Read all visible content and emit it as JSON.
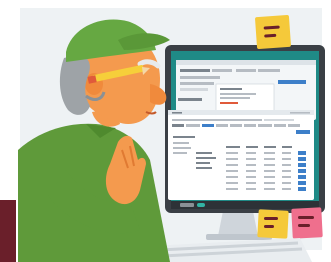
{
  "colors": {
    "background": "#ffffff",
    "backdrop": "#eef2f4",
    "monitor_bezel": "#3a3f45",
    "screen_teal": "#1f8a86",
    "window_white": "#ffffff",
    "accent_blue": "#3d7fc9",
    "accent_red": "#e05a3a",
    "sticky_yellow": "#f5c93a",
    "sticky_pink": "#ef6f8d",
    "cap_green": "#66a842",
    "shirt_green": "#5f9a3a",
    "skin_orange": "#f49a4e",
    "hair_gray": "#9ea3a7",
    "pencil_yellow": "#f6cf3a",
    "dark_accent": "#6a1f2a"
  },
  "icons": {
    "sticky_notes": [
      "sticky-note-icon",
      "sticky-note-icon",
      "sticky-note-icon"
    ],
    "monitor": "monitor-icon",
    "keyboard": "keyboard-icon",
    "pencil": "pencil-icon"
  }
}
